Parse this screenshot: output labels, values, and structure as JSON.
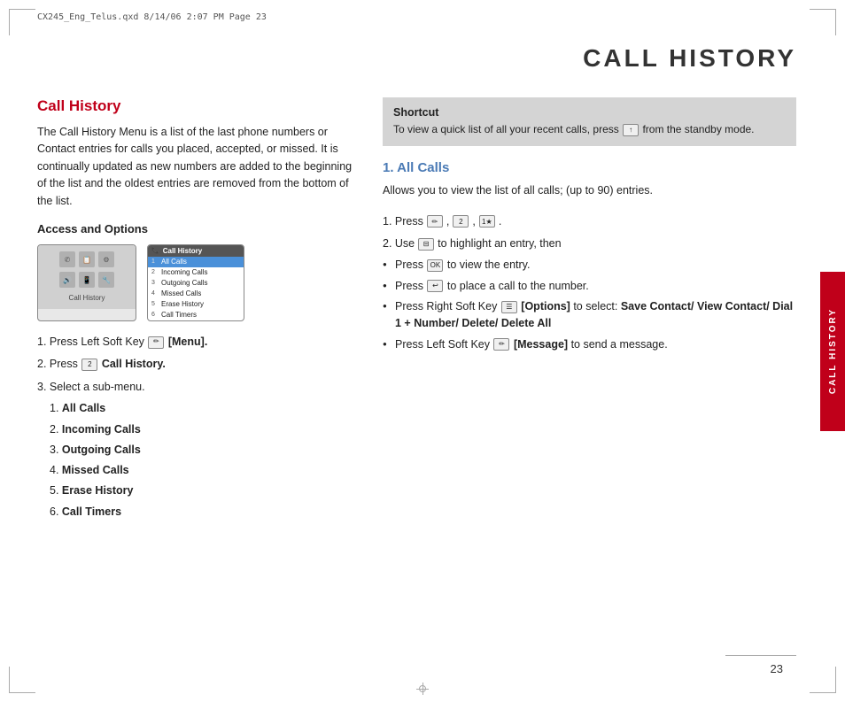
{
  "print_info": "CX245_Eng_Telus.qxd   8/14/06  2:07 PM  Page 23",
  "page_title": "CALL HISTORY",
  "section_title": "Call History",
  "body_text": "The Call History Menu is a list of the last phone numbers or Contact entries for calls you placed, accepted, or missed. It is continually updated as new numbers are added to the beginning of the list and the oldest entries are removed from the bottom of the list.",
  "access_options_heading": "Access and Options",
  "steps": [
    "1. Press Left Soft Key [Menu].",
    "2. Press  2  Call History.",
    "3. Select a sub-menu."
  ],
  "sub_menu_items": [
    "1.  All Calls",
    "2.  Incoming Calls",
    "3.  Outgoing Calls",
    "4.  Missed Calls",
    "5.  Erase History",
    "6.  Call Timers"
  ],
  "shortcut_title": "Shortcut",
  "shortcut_text": "To view a quick list of all your recent calls, press",
  "shortcut_text2": "from the standby mode.",
  "all_calls_heading": "1. All Calls",
  "all_calls_desc": "Allows you to view the list of all calls; (up to 90) entries.",
  "all_calls_step1": "1. Press",
  "all_calls_step1b": ",",
  "all_calls_step2": "2. Use",
  "all_calls_step2b": "to highlight an entry, then",
  "bullets": [
    "Press  OK  to view the entry.",
    "Press  ↩  to place a call to the number.",
    "Press Right Soft Key  [Options] to select: Save Contact/ View Contact/ Dial 1 + Number/ Delete/ Delete All",
    "Press Left Soft Key  [Message] to send a message."
  ],
  "menu_screen": {
    "title": "Call History",
    "items": [
      {
        "num": "1",
        "label": "All Calls",
        "selected": true
      },
      {
        "num": "2",
        "label": "Incoming Calls",
        "selected": false
      },
      {
        "num": "3",
        "label": "Outgoing Calls",
        "selected": false
      },
      {
        "num": "4",
        "label": "Missed Calls",
        "selected": false
      },
      {
        "num": "5",
        "label": "Erase History",
        "selected": false
      },
      {
        "num": "6",
        "label": "Call Timers",
        "selected": false
      }
    ]
  },
  "side_tab_text": "CALL HISTORY",
  "page_number": "23"
}
